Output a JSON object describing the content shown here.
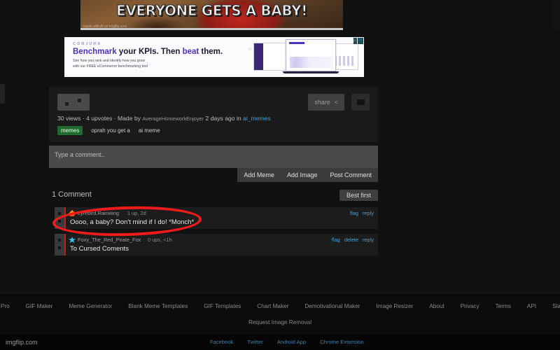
{
  "meme": {
    "title": "EVERYONE GETS A BABY!",
    "watermark": "made with AI on imgflip.com"
  },
  "ad": {
    "brand": "CONJURA",
    "headline_1": "Benchmark",
    "headline_2": " your KPIs. Then ",
    "headline_3": "beat",
    "headline_4": " them.",
    "sub_line_1": "See how you rank and identify how you grow",
    "sub_line_2": "with our FREE eCommerce benchmarking tool",
    "adchoices_icon": "adchoices-triangle-icon",
    "close_icon": "close-x-icon"
  },
  "post": {
    "share_label": "share",
    "share_icon": "share-icon",
    "flag_icon": "flag-icon",
    "upvote_icon": "upvote-arrow-icon",
    "downvote_icon": "downvote-arrow-icon",
    "views": "30 views",
    "sep1": " · ",
    "upvotes": "4 upvotes",
    "sep2": " · Made by ",
    "author": "AverageHomeworkEnjoyer",
    "time": " 2 days ago in ",
    "stream": "ai_memes",
    "tags": [
      "memes",
      "oprah you get a",
      "ai meme"
    ]
  },
  "comment_box": {
    "placeholder": "Type a comment..",
    "add_meme_label": "Add Meme",
    "add_image_label": "Add Image",
    "post_comment_label": "Post Comment"
  },
  "comments_header": {
    "count_label": "1 Comment",
    "sort_label": "Best first"
  },
  "comments": [
    {
      "avatar_icon": "fire-avatar-icon",
      "username": "Lyrebird.Rainwing",
      "score": "1 up, 2d",
      "text": "Oooo, a baby? Don't mind if I do! *Monch*",
      "flag_label": "flag",
      "reply_label": "reply"
    },
    {
      "avatar_icon": "star-avatar-icon",
      "username": "Foxy_The_Red_Pirate_Fox",
      "score": "0 ups, <1h",
      "text": "To Cursed Coments",
      "flag_label": "flag",
      "delete_label": "delete",
      "reply_label": "reply"
    }
  ],
  "annotation": {
    "shape": "red-ellipse-highlight",
    "color": "#f21b1b"
  },
  "footer": {
    "links": [
      "Imgflip Pro",
      "GIF Maker",
      "Meme Generator",
      "Blank Meme Templates",
      "GIF Templates",
      "Chart Maker",
      "Demotivational Maker",
      "Image Resizer",
      "About",
      "Privacy",
      "Terms",
      "API",
      "Slack App"
    ],
    "request": "Request Image Removal",
    "brand": "imgflip.com",
    "social": [
      "Facebook",
      "Twitter",
      "Android App",
      "Chrome Extension"
    ]
  }
}
